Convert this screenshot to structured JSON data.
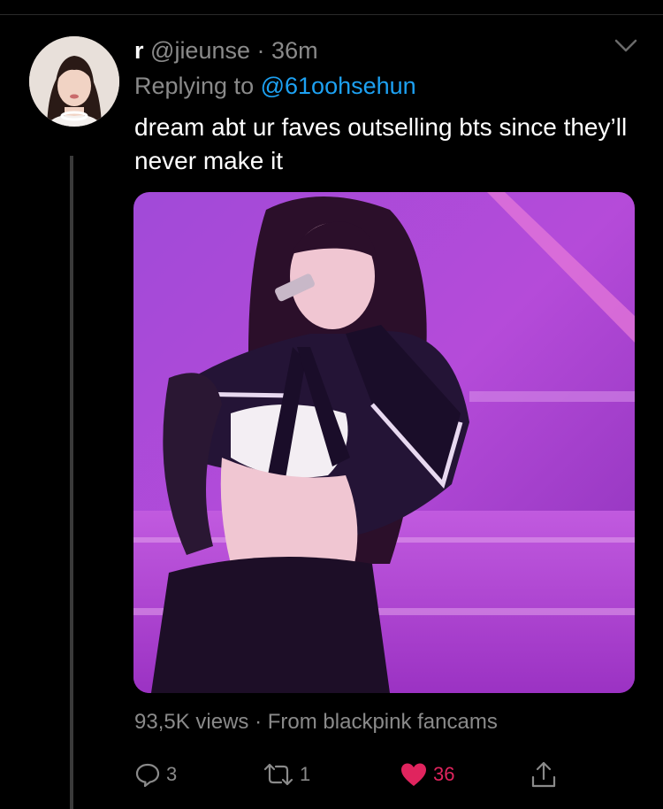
{
  "tweet": {
    "display_name": "r",
    "handle": "@jieunse",
    "separator": "·",
    "time": "36m",
    "replying_prefix": "Replying to",
    "replying_to": "@61oohsehun",
    "text": "dream abt ur faves outselling bts since they’ll never make it",
    "views": "93,5K views",
    "meta_separator": "·",
    "source": "From blackpink fancams"
  },
  "actions": {
    "reply_count": "3",
    "retweet_count": "1",
    "like_count": "36"
  },
  "icons": {
    "more": "chevron-down-icon",
    "reply": "reply-icon",
    "retweet": "retweet-icon",
    "like": "heart-icon",
    "share": "share-icon"
  },
  "colors": {
    "background": "#000000",
    "link": "#1da1f2",
    "muted": "#8a8a8a",
    "like": "#e0245e"
  }
}
